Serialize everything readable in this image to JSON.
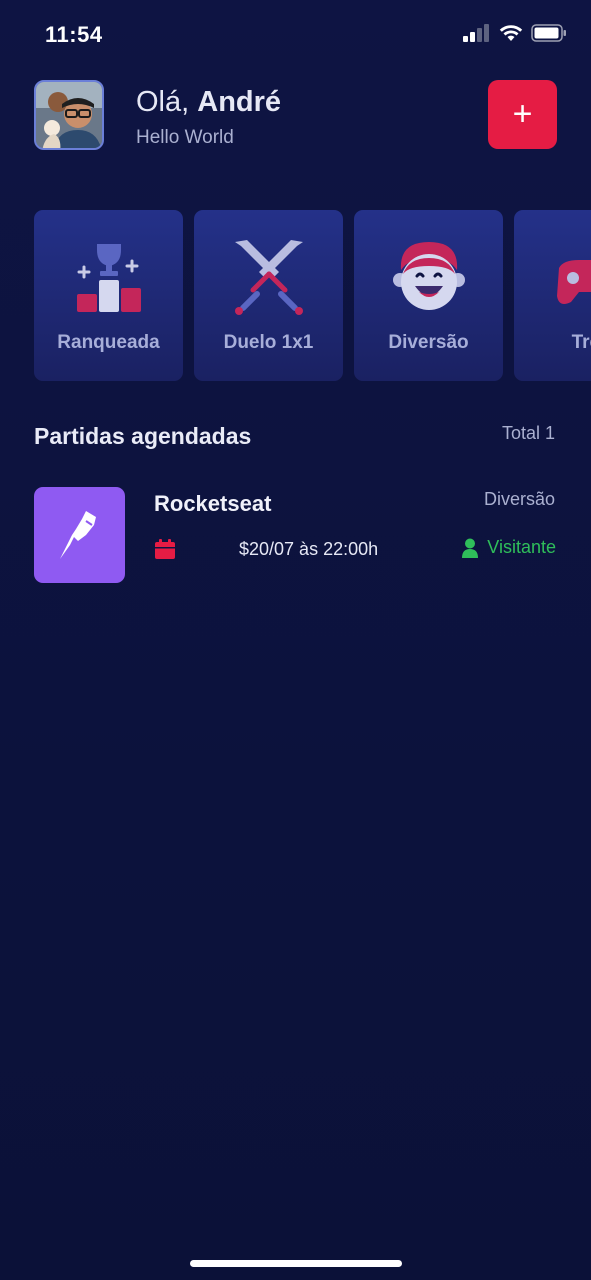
{
  "status_bar": {
    "time": "11:54"
  },
  "header": {
    "greeting_prefix": "Olá,",
    "user_name": "André",
    "subtitle": "Hello World",
    "add_label": "+"
  },
  "categories": [
    {
      "label": "Ranqueada",
      "icon": "trophy-podium-icon"
    },
    {
      "label": "Duelo 1x1",
      "icon": "crossed-swords-icon"
    },
    {
      "label": "Diversão",
      "icon": "smiling-face-icon"
    },
    {
      "label": "Trei",
      "icon": "gamepad-icon"
    }
  ],
  "section": {
    "title": "Partidas agendadas",
    "total": "Total 1"
  },
  "matches": [
    {
      "name": "Rocketseat",
      "category": "Diversão",
      "date": "$20/07 às 22:00h",
      "role": "Visitante"
    }
  ],
  "colors": {
    "background": "#0e1443",
    "accent": "#e51c44",
    "card": "#243189",
    "match_thumb": "#8f5af2",
    "success": "#2fbe5a"
  }
}
